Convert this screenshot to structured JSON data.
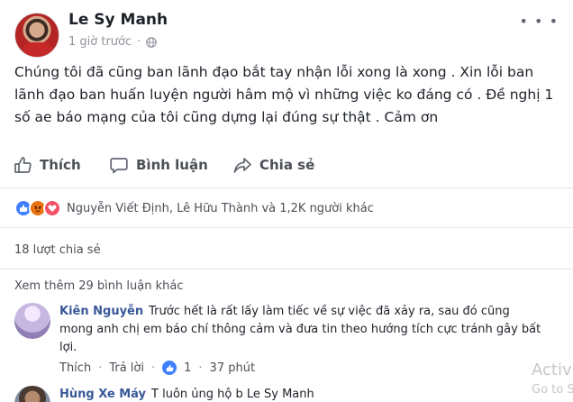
{
  "post": {
    "author": "Le Sy Manh",
    "time": "1 giờ trước",
    "more_label": "• • •",
    "body": "Chúng tôi đã cũng ban lãnh đạo bắt tay nhận lỗi xong là xong . Xin lỗi ban lãnh đạo ban huấn luyện người hâm mộ vì những việc ko đáng có . Đề nghị 1 số ae báo mạng của tôi cũng dựng lại đúng sự thật . Cảm ơn"
  },
  "actions": {
    "like": "Thích",
    "comment": "Bình luận",
    "share": "Chia sẻ"
  },
  "reactions": {
    "names": "Nguyễn Viết Định, Lê Hữu Thành và 1,2K người khác"
  },
  "shares": "18 lượt chia sẻ",
  "view_more": "Xem thêm 29 bình luận khác",
  "comments": [
    {
      "name": "Kiên Nguyễn",
      "text": "Trước hết là rất lấy làm tiếc về sự việc đã xảy ra, sau đó cũng mong anh chị em báo chí thông cảm và đưa tin theo hướng tích cực tránh gây bất lợi.",
      "like_label": "Thích",
      "reply_label": "Trả lời",
      "like_count": "1",
      "time": "37 phút"
    },
    {
      "name": "Hùng Xe Máy",
      "text": "T luôn ủng hộ b Le Sy Manh"
    }
  ],
  "watermark": {
    "line1": "Activ",
    "line2": "Go to S"
  }
}
